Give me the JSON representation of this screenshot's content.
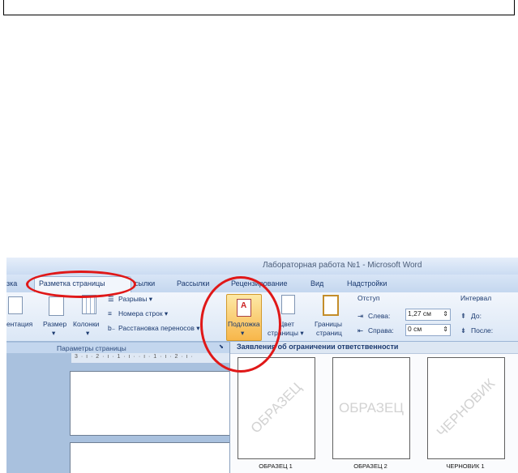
{
  "window_title": "Лабораторная работа №1 - Microsoft Word",
  "tabs": [
    "зка",
    "Разметка страницы",
    "сылки",
    "Рассылки",
    "Рецензирование",
    "Вид",
    "Надстройки"
  ],
  "page_setup": {
    "orientation": "ентация",
    "size": "Размер",
    "columns": "Колонки",
    "breaks": "Разрывы ▾",
    "line_numbers": "Номера строк ▾",
    "hyphenation": "Расстановка переносов ▾",
    "group_label": "Параметры страницы"
  },
  "page_background": {
    "watermark": "Подложка",
    "page_color": "Цвет",
    "page_color_2": "страницы ▾",
    "page_borders": "Границы",
    "page_borders_2": "страниц"
  },
  "indent": {
    "title": "Отступ",
    "left_label": "Слева:",
    "left_value": "1,27 см",
    "right_label": "Справа:",
    "right_value": "0 см"
  },
  "spacing": {
    "title": "Интервал",
    "before_label": "До:",
    "after_label": "После:"
  },
  "ruler": "3 · ı · 2 · ı · 1 · ı ·   · ı · 1 · ı · 2 · ı ·",
  "watermark_gallery": {
    "header": "Заявления об ограничении ответственности",
    "items": [
      {
        "text": "ОБРАЗЕЦ",
        "caption": "ОБРАЗЕЦ 1"
      },
      {
        "text": "ОБРАЗЕЦ",
        "caption": "ОБРАЗЕЦ 2"
      },
      {
        "text": "ЧЕРНОВИК",
        "caption": "ЧЕРНОВИК 1"
      }
    ]
  }
}
